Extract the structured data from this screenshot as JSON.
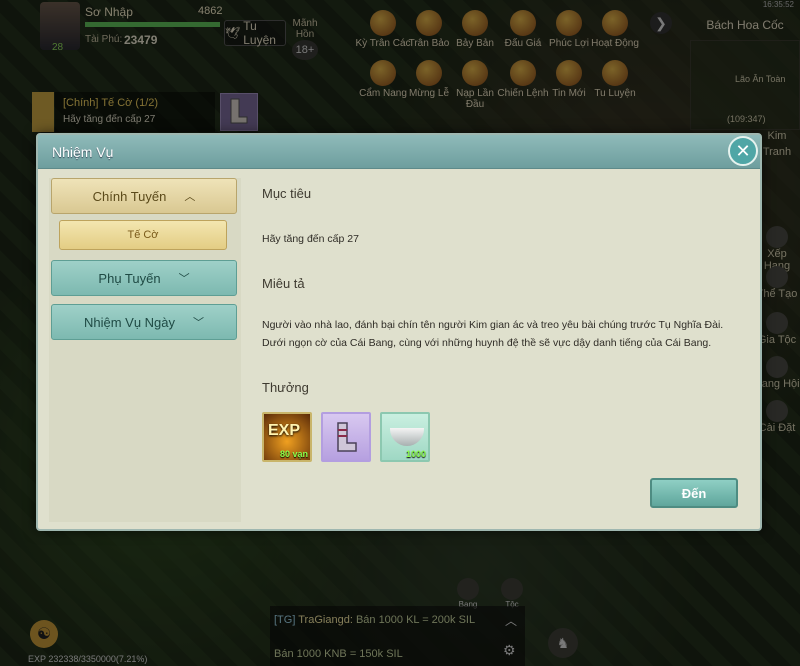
{
  "player": {
    "level": "28",
    "name": "Sơ Nhập",
    "power": "4862",
    "wealth_label": "Tài Phú:",
    "wealth": "23479"
  },
  "top_bar": {
    "cultivate_label": "Tu Luyện",
    "menh_hon_label": "Mãnh Hồn",
    "menh_hon_level": "18+",
    "features_row1": [
      "Kỳ Trân Các",
      "Trân Bảo",
      "Bảy Bản",
      "Đấu Giá",
      "Phúc Lợi",
      "Hoạt Động"
    ],
    "features_row2": [
      "Cẩm Nang",
      "Mừng Lễ",
      "Nạp Lần Đầu",
      "Chiến Lệnh",
      "Tin Mới",
      "Tu Luyện"
    ]
  },
  "right_panel": {
    "time": "16:35:52",
    "market": "Bách Hoa Cốc",
    "map_name": "Lão Ân Toàn",
    "map_coord": "(109:347)",
    "side_items": [
      "Kim",
      "Tranh",
      "Xếp Hạng",
      "Thể Tạo",
      "Gia Tộc",
      "Bang Hội",
      "Cài Đặt"
    ]
  },
  "quest_tracker": {
    "title": "[Chính] Tế Cờ (1/2)",
    "desc": "Hãy tăng đến cấp 27"
  },
  "modal": {
    "title": "Nhiệm Vụ",
    "categories": [
      {
        "label": "Chính Tuyến",
        "expanded": true
      },
      {
        "label": "Phụ Tuyến",
        "expanded": false
      },
      {
        "label": "Nhiệm Vụ Ngày",
        "expanded": false
      }
    ],
    "sub_item": "Tế Cờ",
    "objective_title": "Mục tiêu",
    "objective_text": "Hãy tăng đến cấp 27",
    "description_title": "Miêu tả",
    "description_text": "Người vào nhà lao, đánh bại chín tên người Kim gian ác và treo yêu bài chúng trước Tụ Nghĩa Đài. Dưới ngọn cờ của Cái Bang, cùng với những huynh đệ thề sẽ vực dậy danh tiếng của Cái Bang.",
    "reward_title": "Thưởng",
    "rewards": [
      {
        "icon": "exp-icon",
        "label": "EXP",
        "qty": "80 vạn"
      },
      {
        "icon": "boots-icon",
        "label": "",
        "qty": ""
      },
      {
        "icon": "silver-ingot-icon",
        "label": "",
        "qty": "1000"
      }
    ],
    "go_button": "Đến"
  },
  "bottom": {
    "exp_text": "EXP 232338/3350000(7.21%)",
    "chat_lines": [
      {
        "channel": "[TG]",
        "name": "TraGiangd:",
        "text": "Bán 1000 KL = 200k SIL"
      },
      {
        "channel": "",
        "name": "",
        "text": "Bán 1000 KNB = 150k SIL"
      }
    ],
    "buttons": [
      "Bang",
      "Tộc"
    ]
  }
}
